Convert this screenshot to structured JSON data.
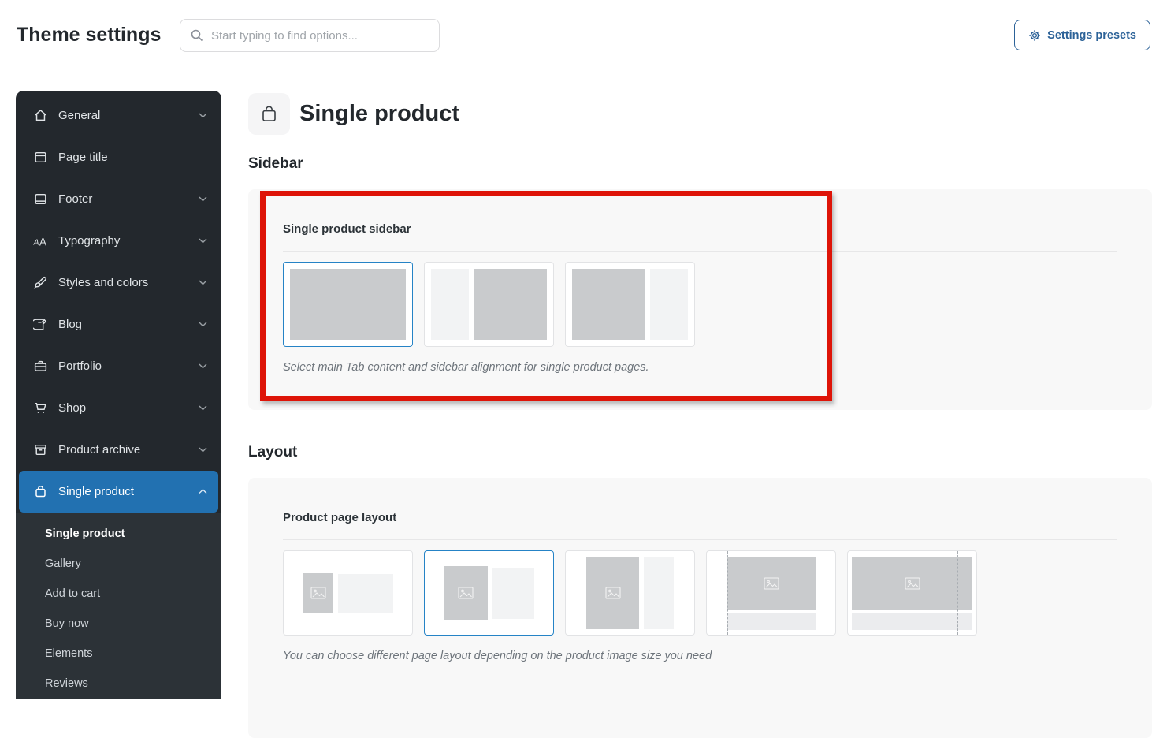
{
  "header": {
    "title": "Theme settings",
    "search_placeholder": "Start typing to find options...",
    "presets_button": "Settings presets"
  },
  "sidebar": {
    "items": [
      {
        "label": "General",
        "icon": "home-icon",
        "chevron": "down"
      },
      {
        "label": "Page title",
        "icon": "page-title-icon",
        "chevron": "none"
      },
      {
        "label": "Footer",
        "icon": "footer-icon",
        "chevron": "down"
      },
      {
        "label": "Typography",
        "icon": "typography-icon",
        "chevron": "down"
      },
      {
        "label": "Styles and colors",
        "icon": "brush-icon",
        "chevron": "down"
      },
      {
        "label": "Blog",
        "icon": "blog-icon",
        "chevron": "down"
      },
      {
        "label": "Portfolio",
        "icon": "portfolio-icon",
        "chevron": "down"
      },
      {
        "label": "Shop",
        "icon": "cart-icon",
        "chevron": "down"
      },
      {
        "label": "Product archive",
        "icon": "archive-icon",
        "chevron": "down"
      },
      {
        "label": "Single product",
        "icon": "bag-icon",
        "chevron": "up",
        "active": true
      }
    ],
    "submenu": [
      {
        "label": "Single product",
        "active": true
      },
      {
        "label": "Gallery",
        "active": false
      },
      {
        "label": "Add to cart",
        "active": false
      },
      {
        "label": "Buy now",
        "active": false
      },
      {
        "label": "Elements",
        "active": false
      },
      {
        "label": "Reviews",
        "active": false
      }
    ]
  },
  "main": {
    "page_title": "Single product",
    "page_icon": "bag-icon",
    "sidebar_section": {
      "heading": "Sidebar",
      "field_label": "Single product sidebar",
      "options": [
        "no-sidebar",
        "sidebar-left",
        "sidebar-right"
      ],
      "selected_option": "no-sidebar",
      "description": "Select main Tab content and sidebar alignment for single product pages."
    },
    "layout_section": {
      "heading": "Layout",
      "field_label": "Product page layout",
      "options": [
        "small-image",
        "medium-image",
        "large-image",
        "wide-image-boxed",
        "wide-image-full"
      ],
      "selected_option": "medium-image",
      "description": "You can choose different page layout depending on the product image size you need"
    }
  },
  "annotation": {
    "type": "highlight-box",
    "target": "single-product-sidebar-field"
  },
  "colors": {
    "accent_blue": "#2271b1",
    "annotation_red": "#de1408",
    "sidebar_bg": "#23282d",
    "submenu_bg": "#2c3237",
    "panel_bg": "#f8f8f8",
    "button_blue": "#2c6298"
  }
}
